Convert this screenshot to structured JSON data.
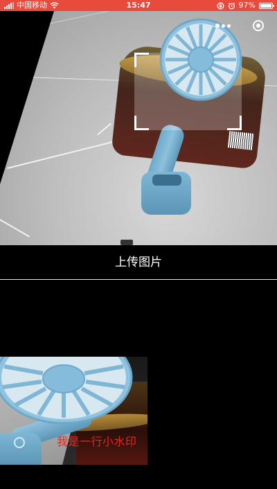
{
  "status_bar": {
    "carrier": "中国移动",
    "time": "15:47",
    "battery_percent": "97%",
    "battery_level": 0.97
  },
  "camera": {
    "capsule_more_icon": "more-dots-icon",
    "capsule_close_icon": "record-close-icon"
  },
  "upload": {
    "label": "上传图片"
  },
  "result": {
    "watermark_text": "我是一行小水印",
    "watermark_color": "#e8261d"
  },
  "colors": {
    "status_bar": "#e84a3c",
    "background": "#000000",
    "divider": "#e6e6e6"
  }
}
